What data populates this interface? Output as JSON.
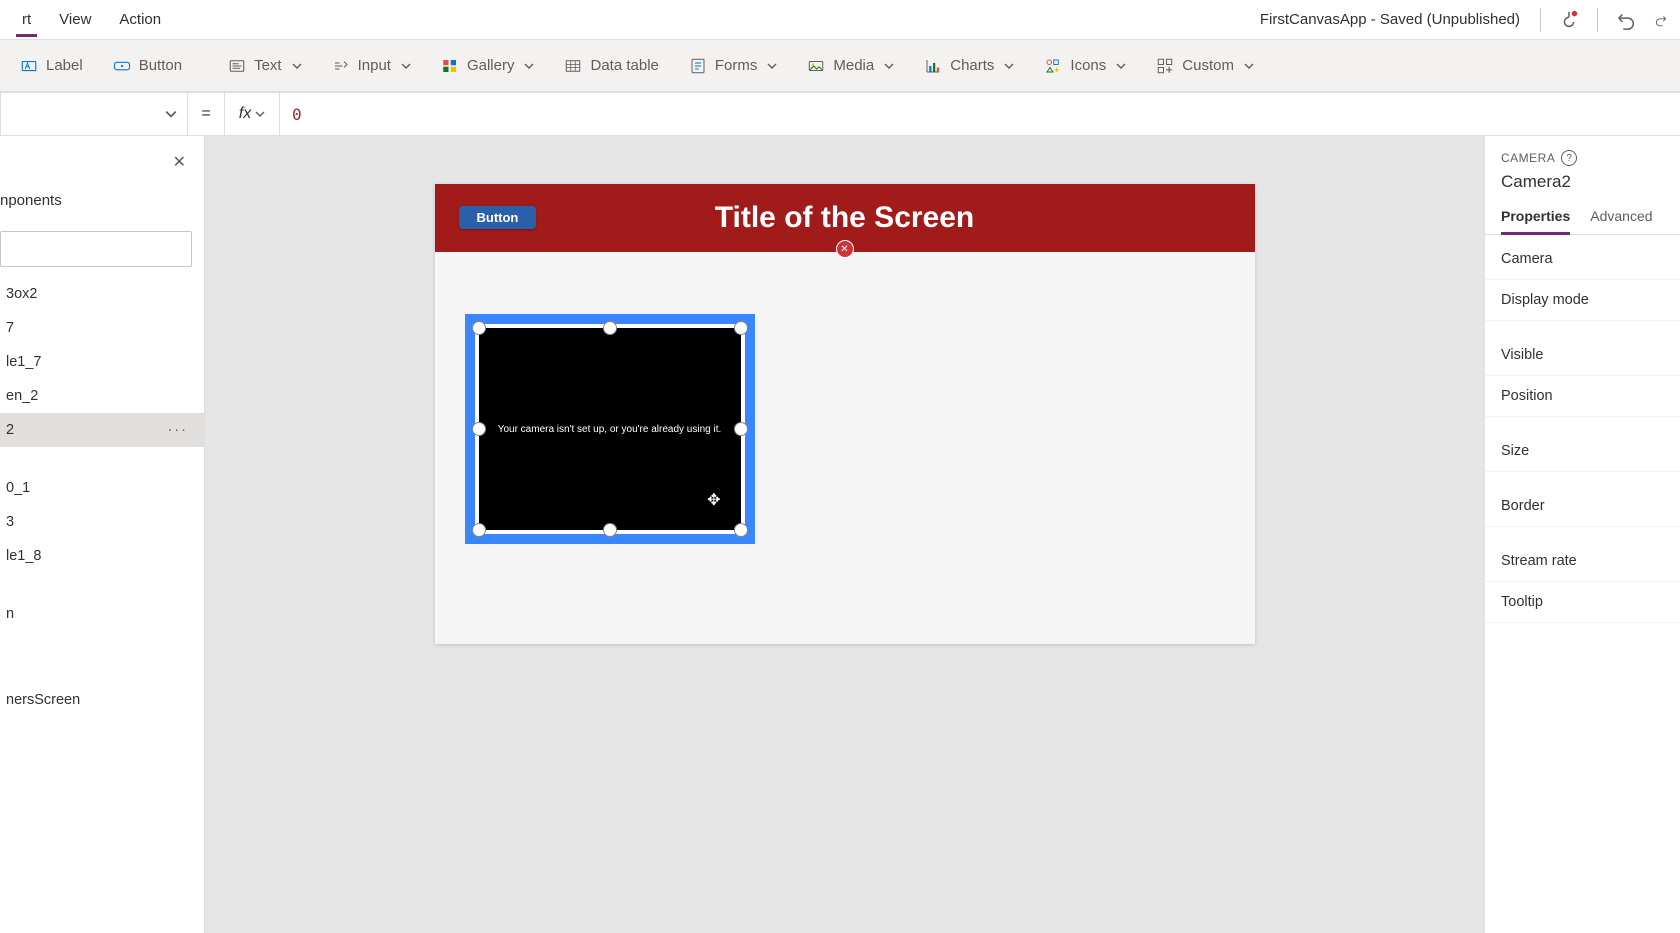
{
  "menu": {
    "items": [
      "rt",
      "View",
      "Action"
    ],
    "active_index": 0,
    "doc_title": "FirstCanvasApp - Saved (Unpublished)"
  },
  "ribbon": {
    "label": "Label",
    "button": "Button",
    "text": "Text",
    "input": "Input",
    "gallery": "Gallery",
    "datatable": "Data table",
    "forms": "Forms",
    "media": "Media",
    "charts": "Charts",
    "icons": "Icons",
    "custom": "Custom"
  },
  "formula": {
    "eq": "=",
    "fx": "fx",
    "value": "0"
  },
  "left": {
    "tab": "nponents",
    "items": [
      "3ox2",
      "7",
      "le1_7",
      "en_2",
      "2",
      "0_1",
      "3",
      "le1_8",
      "n",
      "nersScreen"
    ],
    "selected_index": 4
  },
  "canvas": {
    "button_label": "Button",
    "title": "Title of the Screen",
    "camera_msg": "Your camera isn't set up, or you're already using it."
  },
  "right": {
    "type_label": "CAMERA",
    "name": "Camera2",
    "tabs": {
      "properties": "Properties",
      "advanced": "Advanced"
    },
    "rows": [
      "Camera",
      "Display mode",
      "Visible",
      "Position",
      "Size",
      "Border",
      "Stream rate",
      "Tooltip"
    ]
  }
}
